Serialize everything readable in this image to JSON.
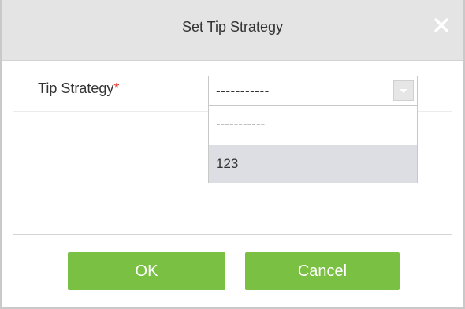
{
  "dialog": {
    "title": "Set Tip Strategy",
    "close_icon": "close-icon"
  },
  "form": {
    "label": "Tip Strategy",
    "required_marker": "*",
    "select": {
      "value": "-----------",
      "options": [
        "-----------",
        "123"
      ],
      "hovered_option": "123"
    }
  },
  "buttons": {
    "ok": "OK",
    "cancel": "Cancel"
  },
  "colors": {
    "title_bar": "#e4e4e4",
    "button": "#7ac143",
    "required": "#e53935",
    "hover_option": "#dcdee3"
  }
}
